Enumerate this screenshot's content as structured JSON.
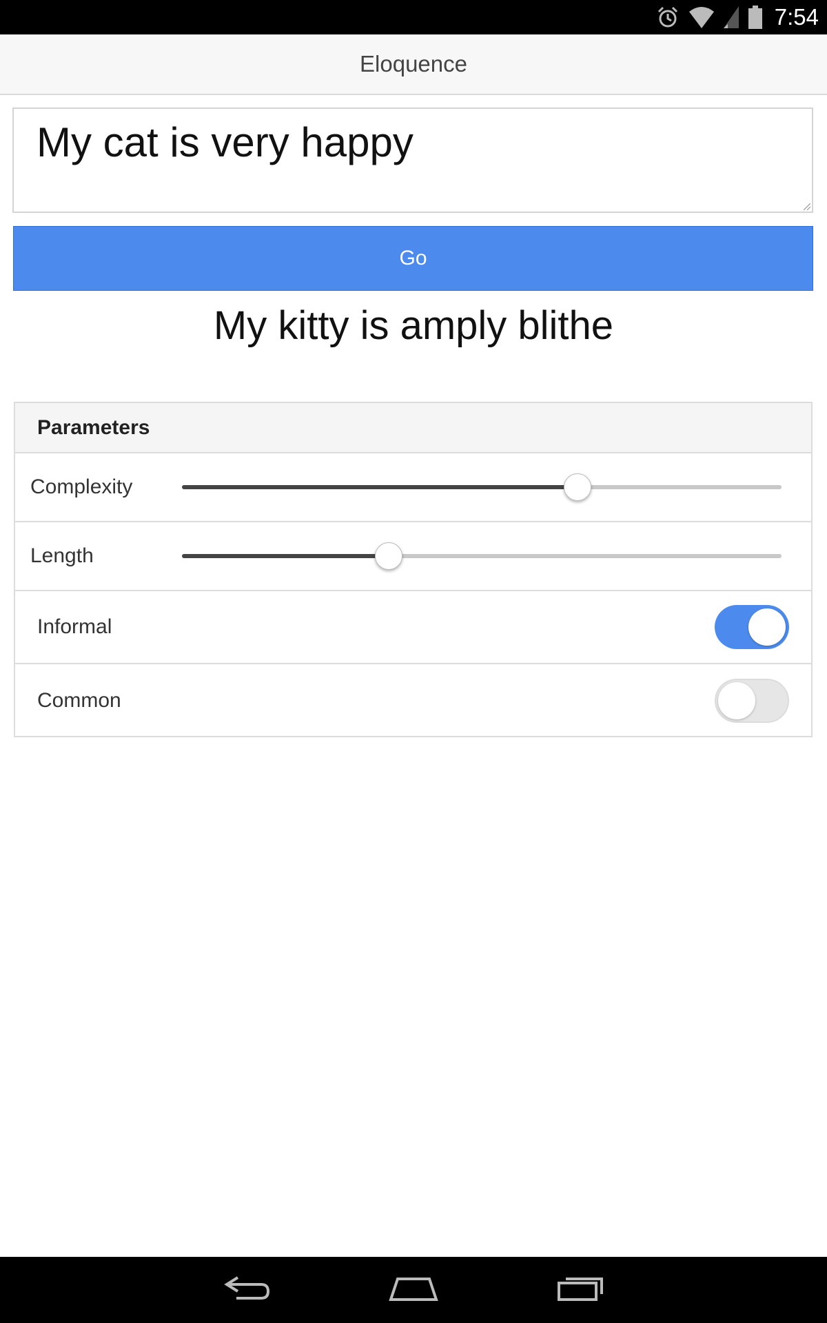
{
  "status_bar": {
    "time": "7:54",
    "icons": [
      "alarm-icon",
      "wifi-icon",
      "cell-signal-icon",
      "battery-icon"
    ]
  },
  "header": {
    "title": "Eloquence"
  },
  "input": {
    "value": "My cat is very happy"
  },
  "go_button": {
    "label": "Go",
    "color": "#4c8bed"
  },
  "result": {
    "text": "My kitty is amply blithe"
  },
  "parameters": {
    "title": "Parameters",
    "complexity": {
      "label": "Complexity",
      "value": 0.66
    },
    "length": {
      "label": "Length",
      "value": 0.345
    },
    "informal": {
      "label": "Informal",
      "checked": true
    },
    "common": {
      "label": "Common",
      "checked": false
    }
  },
  "nav_bar": {
    "icons": [
      "back-icon",
      "home-icon",
      "recents-icon"
    ]
  }
}
